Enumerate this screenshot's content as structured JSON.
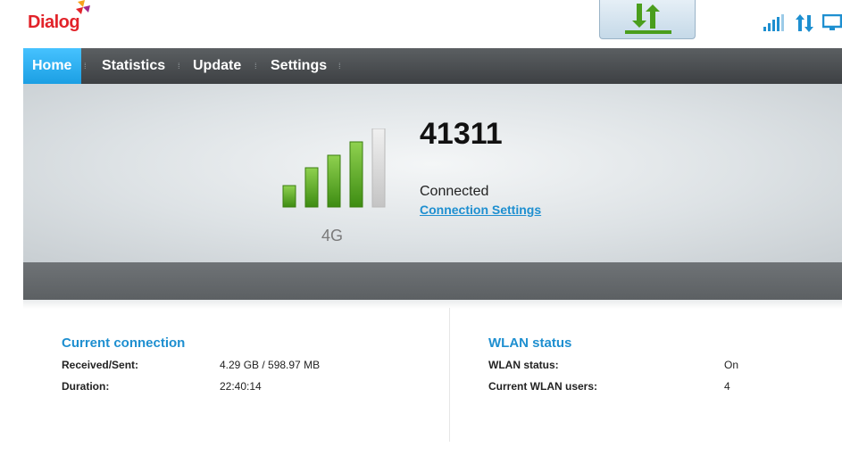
{
  "header": {
    "logo_text": "Dialog"
  },
  "nav": {
    "items": [
      {
        "label": "Home",
        "active": true
      },
      {
        "label": "Statistics",
        "active": false
      },
      {
        "label": "Update",
        "active": false
      },
      {
        "label": "Settings",
        "active": false
      }
    ]
  },
  "status": {
    "carrier": "41311",
    "network_type": "4G",
    "connection_status": "Connected",
    "connection_settings_link": "Connection Settings",
    "signal_bars_active": 4,
    "signal_bars_total": 5
  },
  "current_connection": {
    "title": "Current connection",
    "rows": [
      {
        "label": "Received/Sent:",
        "value": "4.29 GB /  598.97 MB"
      },
      {
        "label": "Duration:",
        "value": "22:40:14"
      }
    ]
  },
  "wlan": {
    "title": "WLAN status",
    "rows": [
      {
        "label": "WLAN status:",
        "value": "On"
      },
      {
        "label": "Current WLAN users:",
        "value": "4"
      }
    ]
  },
  "colors": {
    "accent": "#1e8fd0",
    "brand": "#e2232a",
    "signal_green": "#4fa61e",
    "nav_active": "#2cb0f2"
  },
  "icons": [
    "dialog-logo-icon",
    "update-arrows-icon",
    "signal-strength-icon",
    "data-transfer-icon",
    "pc-connection-icon"
  ]
}
